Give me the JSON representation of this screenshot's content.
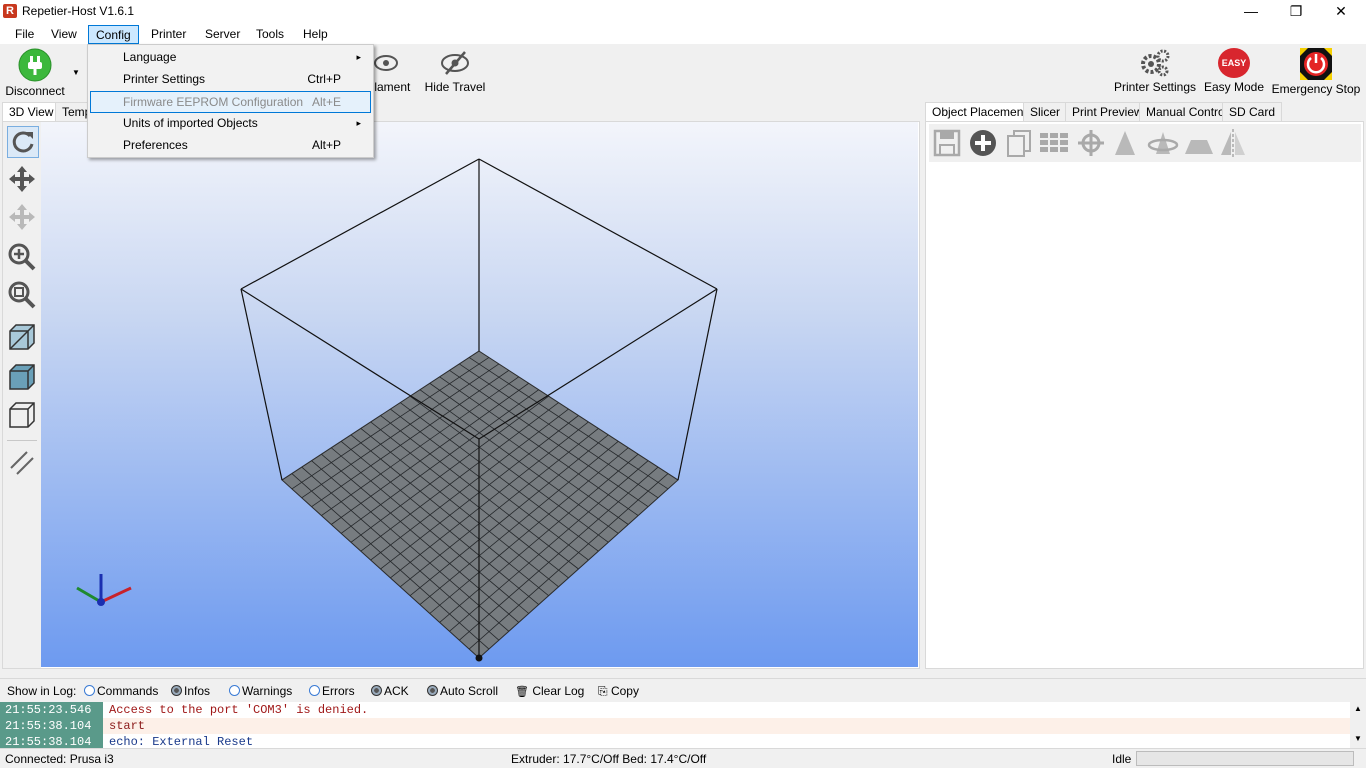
{
  "window": {
    "title": "Repetier-Host V1.6.1",
    "logo_letter": "R",
    "controls": {
      "minimize": "—",
      "maximize": "❐",
      "close": "✕"
    }
  },
  "menubar": [
    "File",
    "View",
    "Config",
    "Printer",
    "Server",
    "Tools",
    "Help"
  ],
  "config_menu": {
    "items": [
      {
        "label": "Language",
        "shortcut": "",
        "submenu": "▸"
      },
      {
        "label": "Printer Settings",
        "shortcut": "Ctrl+P",
        "submenu": ""
      },
      {
        "label": "Firmware EEPROM Configuration",
        "shortcut": "Alt+E",
        "submenu": ""
      },
      {
        "label": "Units of imported Objects",
        "shortcut": "",
        "submenu": "▸"
      },
      {
        "label": "Preferences",
        "shortcut": "Alt+P",
        "submenu": ""
      }
    ]
  },
  "toolbar": {
    "disconnect": "Disconnect",
    "show_filament_partial": "ilament",
    "hide_travel": "Hide Travel",
    "printer_settings": "Printer Settings",
    "easy_mode": "Easy Mode",
    "easy_badge": "EASY",
    "emergency_stop": "Emergency Stop"
  },
  "left_tabs": [
    "3D View",
    "Temp"
  ],
  "right_tabs": [
    "Object Placement",
    "Slicer",
    "Print Preview",
    "Manual Control",
    "SD Card"
  ],
  "log": {
    "show_in_log": "Show in Log:",
    "options": [
      {
        "label": "Commands",
        "on": false
      },
      {
        "label": "Infos",
        "on": true
      },
      {
        "label": "Warnings",
        "on": false
      },
      {
        "label": "Errors",
        "on": false
      },
      {
        "label": "ACK",
        "on": true
      },
      {
        "label": "Auto Scroll",
        "on": true
      }
    ],
    "clear_log": "Clear Log",
    "copy": "Copy",
    "entries": [
      {
        "time": "21:55:23.546",
        "message": "Access to the port 'COM3' is denied.",
        "level": "error"
      },
      {
        "time": "21:55:38.104",
        "message": "start",
        "level": "info"
      },
      {
        "time": "21:55:38.104",
        "message": "echo: External Reset",
        "level": "echo"
      }
    ]
  },
  "status": {
    "connection": "Connected: Prusa i3",
    "temps": "Extruder: 17.7°C/Off Bed: 17.4°C/Off",
    "state": "Idle"
  },
  "colors": {
    "accent": "#0078d7",
    "log_error": "#a01818",
    "log_info": "#8b1a1a",
    "log_echo": "#1a3a8b",
    "disconnect_green": "#3cb83c",
    "easy_red": "#d8262e"
  }
}
